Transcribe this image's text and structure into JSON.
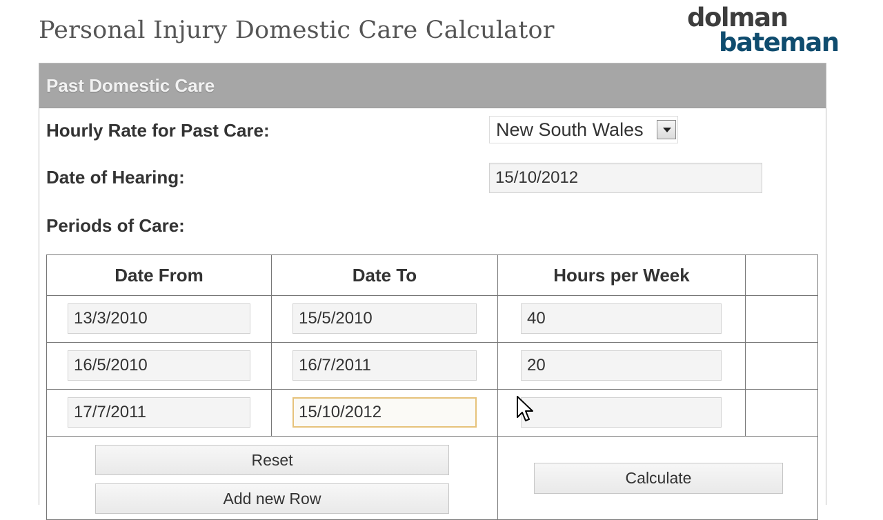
{
  "page": {
    "title": "Personal Injury Domestic Care Calculator"
  },
  "logo": {
    "line1": "dolman",
    "line2": "bateman"
  },
  "section": {
    "title": "Past Domestic Care"
  },
  "form": {
    "hourly_rate_label": "Hourly Rate for Past Care:",
    "hourly_rate_value": "New South Wales",
    "hearing_date_label": "Date of Hearing:",
    "hearing_date_value": "15/10/2012",
    "periods_label": "Periods of Care:"
  },
  "table": {
    "headers": [
      "Date From",
      "Date To",
      "Hours per Week",
      ""
    ],
    "rows": [
      {
        "from": "13/3/2010",
        "to": "15/5/2010",
        "hours": "40"
      },
      {
        "from": "16/5/2010",
        "to": "16/7/2011",
        "hours": "20"
      },
      {
        "from": "17/7/2011",
        "to": "15/10/2012",
        "hours": ""
      }
    ]
  },
  "buttons": {
    "reset": "Reset",
    "add_row": "Add new Row",
    "calculate": "Calculate"
  },
  "icons": {
    "dropdown": "chevron-down-icon",
    "cursor": "mouse-pointer-icon"
  },
  "colors": {
    "header_bg": "#a6a6a6",
    "focus_border": "#e6c27a",
    "logo_dark": "#3d3d3d",
    "logo_blue": "#0f4c6e"
  }
}
